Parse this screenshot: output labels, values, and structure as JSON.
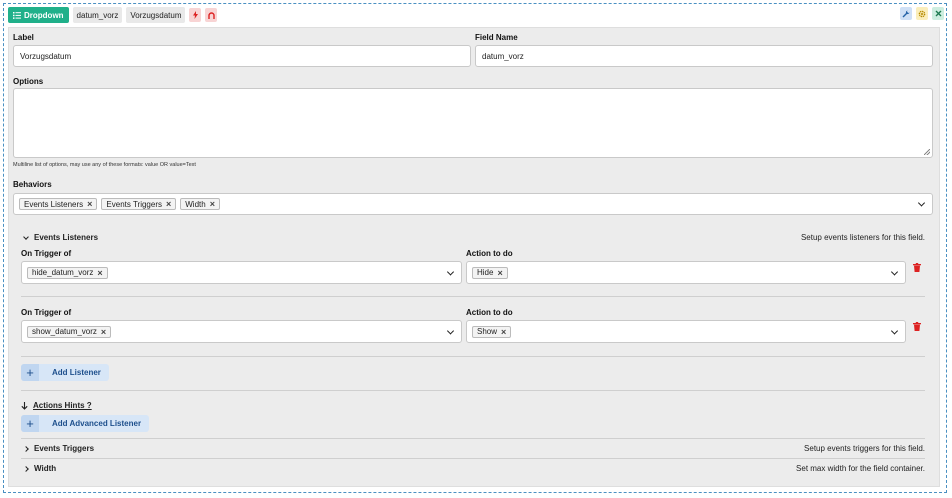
{
  "header": {
    "type_icon": "list-icon",
    "type_label": "Dropdown",
    "field_name_chip": "datum_vorz",
    "label_chip": "Vorzugsdatum",
    "right_buttons": [
      "wrench-icon",
      "gear-icon",
      "close-icon"
    ]
  },
  "form": {
    "label": {
      "title": "Label",
      "value": "Vorzugsdatum"
    },
    "field_name": {
      "title": "Field Name",
      "value": "datum_vorz"
    },
    "options": {
      "title": "Options",
      "value": "",
      "hint": "Multiline list of options, may use any of these formats: value OR value=Text"
    },
    "behaviors": {
      "title": "Behaviors",
      "tags": [
        "Events Listeners",
        "Events Triggers",
        "Width"
      ]
    }
  },
  "events_listeners": {
    "title": "Events Listeners",
    "note": "Setup events listeners for this field.",
    "on_trigger_label": "On Trigger of",
    "action_label": "Action to do",
    "rows": [
      {
        "trigger": "hide_datum_vorz",
        "action": "Hide"
      },
      {
        "trigger": "show_datum_vorz",
        "action": "Show"
      }
    ],
    "add_listener": "Add Listener",
    "actions_hints": "Actions Hints ?",
    "add_advanced": "Add Advanced Listener"
  },
  "events_triggers": {
    "title": "Events Triggers",
    "note": "Setup events triggers for this field."
  },
  "width": {
    "title": "Width",
    "note": "Set max width for the field container."
  },
  "colors": {
    "accent": "#20b08a",
    "danger": "#d22222",
    "button_bg": "#d7e6f7"
  }
}
